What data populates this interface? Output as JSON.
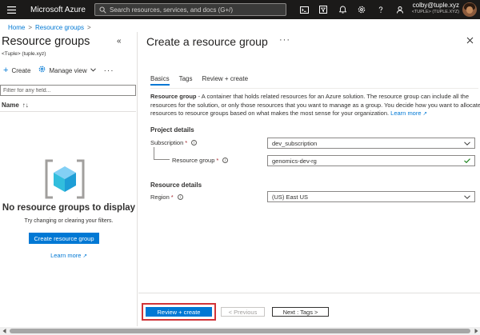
{
  "topbar": {
    "brand": "Microsoft Azure",
    "search_placeholder": "Search resources, services, and docs (G+/)",
    "icons": [
      "cloud-shell-icon",
      "directory-filter-icon",
      "notifications-icon",
      "settings-icon",
      "help-icon",
      "feedback-icon"
    ],
    "user_name": "colby@tuple.xyz",
    "user_tenant": "<TUPLE> (TUPLE.XYZ)"
  },
  "breadcrumb": {
    "home": "Home",
    "separator": ">",
    "current": "Resource groups",
    "trailing": ">"
  },
  "left": {
    "title": "Resource groups",
    "collapse": "«",
    "subtitle": "<Tuple> (tuple.xyz)",
    "create_label": "Create",
    "manage_view_label": "Manage view",
    "more": "···",
    "filter_placeholder": "Filter for any field...",
    "column_name": "Name",
    "sort_glyph": "↑↓",
    "empty_title": "No resource groups to display",
    "empty_subtitle": "Try changing or clearing your filters.",
    "create_button": "Create resource group",
    "learn_more": "Learn more"
  },
  "blade": {
    "title": "Create a resource group",
    "more": "···",
    "tabs": [
      {
        "label": "Basics",
        "active": true
      },
      {
        "label": "Tags",
        "active": false
      },
      {
        "label": "Review + create",
        "active": false
      }
    ],
    "description_bold": "Resource group",
    "description_rest": " - A container that holds related resources for an Azure solution. The resource group can include all the resources for the solution, or only those resources that you want to manage as a group. You decide how you want to allocate resources to resource groups based on what makes the most sense for your organization.",
    "learn_more": "Learn more",
    "project_details": "Project details",
    "subscription_label": "Subscription",
    "subscription_value": "dev_subscription",
    "resource_group_label": "Resource group",
    "resource_group_value": "genomics-dev-rg",
    "resource_details": "Resource details",
    "region_label": "Region",
    "region_value": "(US) East US",
    "required_mark": "*",
    "info_glyph": "i"
  },
  "footer": {
    "review_create": "Review + create",
    "previous": "< Previous",
    "next": "Next : Tags >"
  },
  "colors": {
    "accent": "#0078d4",
    "highlight_border": "#d13438",
    "topbar_bg": "#1b1a19",
    "valid_check": "#107c10"
  }
}
